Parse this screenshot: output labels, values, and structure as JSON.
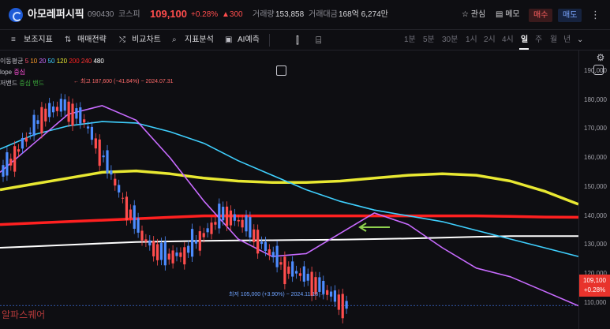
{
  "header": {
    "stock_name": "아모레퍼시픽",
    "stock_code": "090430",
    "market": "코스피",
    "price": "109,100",
    "change_pct": "+0.28%",
    "change_abs": "▲300",
    "volume_label": "거래량",
    "volume": "153,858",
    "amount_label": "거래대금",
    "amount": "168억 6,274만",
    "watch_label": "관심",
    "memo_label": "메모",
    "buy_label": "매수",
    "sell_label": "매도"
  },
  "toolbar": {
    "items": [
      "보조지표",
      "매매전략",
      "비교차트",
      "지표분석",
      "AI예측"
    ],
    "periods": [
      "1분",
      "5분",
      "30분",
      "1시",
      "2시",
      "4시",
      "일",
      "주",
      "월",
      "년"
    ],
    "active_period": "일"
  },
  "legend": {
    "ma_label": "이동평균",
    "ma_periods": [
      "5",
      "10",
      "20",
      "50",
      "120",
      "200",
      "240",
      "480"
    ],
    "ma_colors": [
      "#ff4d6a",
      "#ff9c2a",
      "#c86bff",
      "#3fd0ff",
      "#e8e832",
      "#ff2020",
      "#ff3333",
      "#ffffff"
    ],
    "envelope_label": "lope",
    "envelope_sub": "중심",
    "band_label": "저밴드",
    "band_sub": "중심 밴드"
  },
  "annotations": {
    "high": "← 최고 187,600 (−41.84%) − 2024.07.31",
    "low": "최저 105,000 (+3.90%) − 2024.11.18 →"
  },
  "axis": {
    "ticks": [
      "190,000",
      "180,000",
      "170,000",
      "160,000",
      "150,000",
      "140,000",
      "130,000",
      "120,000",
      "110,000"
    ],
    "current_price": "109,100",
    "current_change": "+0.28%"
  },
  "watermark": "알파스퀘어",
  "chart_data": {
    "type": "candlestick",
    "ylim": [
      101000,
      197000
    ],
    "high": {
      "value": 187600,
      "date": "2024.07.31"
    },
    "low": {
      "value": 105000,
      "date": "2024.11.18"
    },
    "current": 109100,
    "lines": [
      {
        "name": "120",
        "color": "#e8e832",
        "values": [
          149000,
          151000,
          153000,
          155000,
          155500,
          154500,
          153000,
          152000,
          151500,
          151500,
          152000,
          153000,
          154000,
          154500,
          154000,
          152000,
          148500,
          144000
        ]
      },
      {
        "name": "200",
        "color": "#ff2020",
        "values": [
          137000,
          137500,
          138000,
          138500,
          139000,
          139500,
          140000,
          140000,
          140000,
          140000,
          140000,
          140000,
          140000,
          140000,
          140000,
          139800,
          139600,
          139500
        ]
      },
      {
        "name": "480",
        "color": "#ffffff",
        "values": [
          129000,
          129500,
          130000,
          130500,
          131000,
          131200,
          131400,
          131500,
          131600,
          131700,
          131800,
          132000,
          132200,
          132500,
          132800,
          133000,
          133000,
          133000
        ]
      },
      {
        "name": "50",
        "color": "#3fd0ff",
        "values": [
          163000,
          168000,
          171000,
          172500,
          172000,
          169000,
          165000,
          159000,
          154000,
          149000,
          145000,
          142000,
          140000,
          138000,
          135000,
          132000,
          129000,
          126000
        ]
      },
      {
        "name": "20",
        "color": "#c86bff",
        "values": [
          155000,
          165000,
          175000,
          178000,
          173000,
          160000,
          145000,
          132000,
          126000,
          127000,
          134000,
          141000,
          137000,
          129000,
          122000,
          119000,
          114000,
          109000
        ]
      }
    ]
  }
}
